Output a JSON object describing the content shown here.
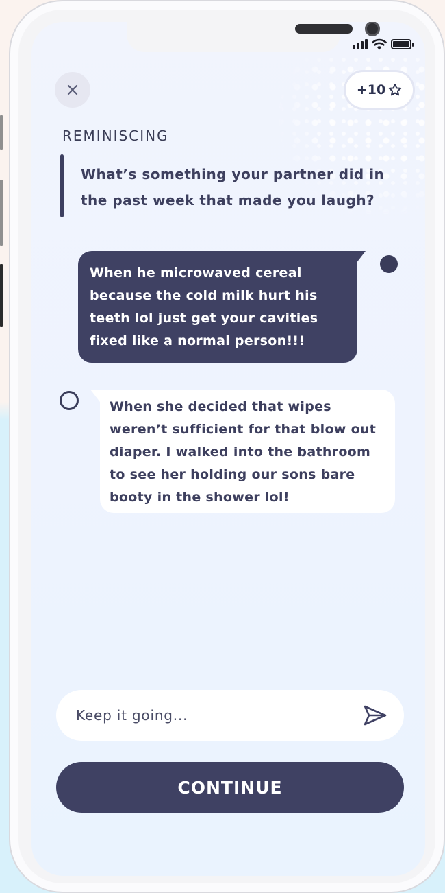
{
  "status_bar": {
    "icons": [
      "cellular-signal-icon",
      "wifi-icon",
      "battery-icon"
    ]
  },
  "header": {
    "close_icon": "close-icon",
    "points_label": "+10",
    "points_icon": "star-outline-icon"
  },
  "prompt": {
    "category": "REMINISCING",
    "question": "What’s something your partner did in the past week that made you laugh?"
  },
  "messages": [
    {
      "side": "me",
      "text": "When he microwaved cereal because the cold milk hurt his teeth lol just get your cavities fixed like a normal person!!!"
    },
    {
      "side": "partner",
      "text": "When she decided that wipes weren’t sufficient for that blow out diaper. I walked into the bathroom to see her holding our sons bare booty in the shower lol!"
    }
  ],
  "composer": {
    "placeholder": "Keep it going...",
    "send_icon": "send-icon"
  },
  "footer": {
    "continue_label": "CONTINUE"
  },
  "colors": {
    "primary": "#3f4163",
    "background": "#eef3fe",
    "bubble_light": "#ffffff"
  }
}
